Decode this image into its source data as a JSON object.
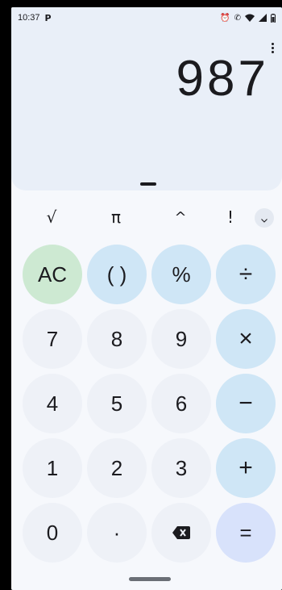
{
  "status_bar": {
    "time": "10:37",
    "left_icons": [
      "pay-icon"
    ],
    "right_icons": [
      "alarm-icon",
      "call-icon",
      "wifi-icon",
      "signal-icon",
      "battery-icon"
    ]
  },
  "display": {
    "result": "987"
  },
  "scientific_row": {
    "items": [
      {
        "label": "√",
        "name": "sqrt"
      },
      {
        "label": "π",
        "name": "pi"
      },
      {
        "label": "^",
        "name": "power"
      },
      {
        "label": "!",
        "name": "factorial"
      }
    ],
    "expand_icon": "chevron-down-icon"
  },
  "keypad": {
    "rows": [
      [
        {
          "label": "AC",
          "name": "clear-button",
          "kind": "clear"
        },
        {
          "label": "( )",
          "name": "parentheses-button",
          "kind": "func"
        },
        {
          "label": "%",
          "name": "percent-button",
          "kind": "func"
        },
        {
          "label": "÷",
          "name": "divide-button",
          "kind": "op"
        }
      ],
      [
        {
          "label": "7",
          "name": "digit-7-button",
          "kind": "digit"
        },
        {
          "label": "8",
          "name": "digit-8-button",
          "kind": "digit"
        },
        {
          "label": "9",
          "name": "digit-9-button",
          "kind": "digit"
        },
        {
          "label": "×",
          "name": "multiply-button",
          "kind": "op"
        }
      ],
      [
        {
          "label": "4",
          "name": "digit-4-button",
          "kind": "digit"
        },
        {
          "label": "5",
          "name": "digit-5-button",
          "kind": "digit"
        },
        {
          "label": "6",
          "name": "digit-6-button",
          "kind": "digit"
        },
        {
          "label": "−",
          "name": "subtract-button",
          "kind": "op"
        }
      ],
      [
        {
          "label": "1",
          "name": "digit-1-button",
          "kind": "digit"
        },
        {
          "label": "2",
          "name": "digit-2-button",
          "kind": "digit"
        },
        {
          "label": "3",
          "name": "digit-3-button",
          "kind": "digit"
        },
        {
          "label": "+",
          "name": "add-button",
          "kind": "op"
        }
      ],
      [
        {
          "label": "0",
          "name": "digit-0-button",
          "kind": "digit"
        },
        {
          "label": "·",
          "name": "decimal-button",
          "kind": "digit"
        },
        {
          "label": "",
          "name": "backspace-button",
          "kind": "delete"
        },
        {
          "label": "=",
          "name": "equals-button",
          "kind": "equals"
        }
      ]
    ]
  },
  "colors": {
    "display_bg": "#e9eff8",
    "digit_key": "#eef1f7",
    "operator_key": "#cfe6f6",
    "clear_key": "#cde9d2",
    "equals_key": "#d8e2fb"
  }
}
